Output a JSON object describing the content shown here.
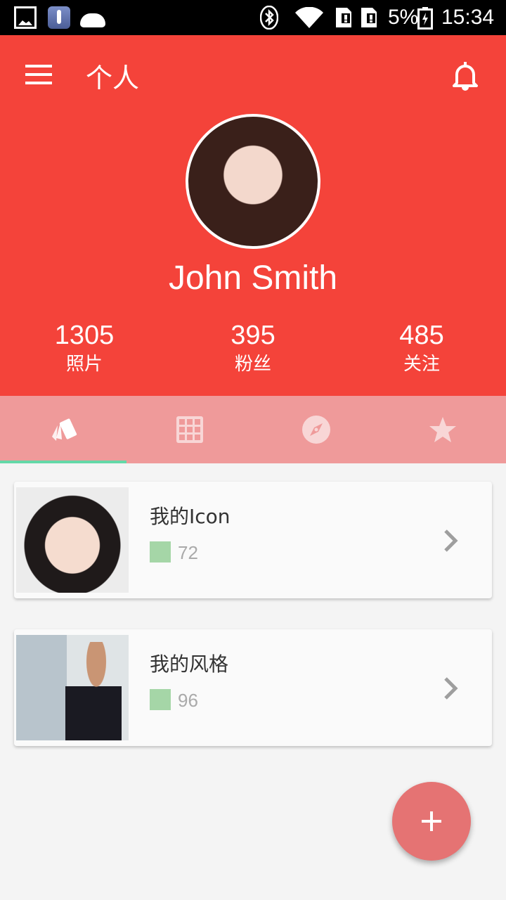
{
  "status_bar": {
    "battery": "5%",
    "time": "15:34",
    "icons": [
      "gallery-icon",
      "thermometer-icon",
      "android-icon",
      "bluetooth-icon",
      "wifi-icon",
      "sim1-icon",
      "sim2-icon",
      "battery-icon"
    ]
  },
  "header": {
    "title": "个人",
    "menu_icon": "menu-icon",
    "bell_icon": "bell-icon",
    "user_name": "John Smith",
    "stats": [
      {
        "value": "1305",
        "label": "照片"
      },
      {
        "value": "395",
        "label": "粉丝"
      },
      {
        "value": "485",
        "label": "关注"
      }
    ]
  },
  "tabs": [
    {
      "icon": "cards-icon",
      "active": true
    },
    {
      "icon": "grid-icon",
      "active": false
    },
    {
      "icon": "compass-icon",
      "active": false
    },
    {
      "icon": "star-icon",
      "active": false
    }
  ],
  "cards": [
    {
      "title": "我的Icon",
      "count": "72"
    },
    {
      "title": "我的风格",
      "count": "96"
    }
  ],
  "fab": {
    "icon": "plus-icon"
  },
  "colors": {
    "primary": "#f4433a",
    "tab_bar": "#ef9a9a",
    "indicator": "#64d8a8",
    "swatch": "#a5d6a7",
    "fab": "#e57373"
  }
}
